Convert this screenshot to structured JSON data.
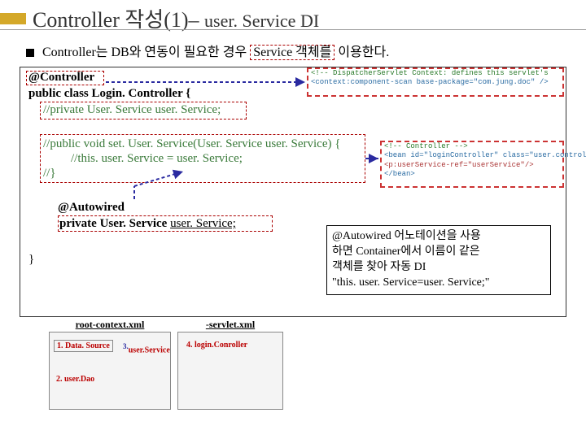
{
  "title_main": "Controller 작성(1)–",
  "title_sub": "user. Service  DI",
  "bullet": {
    "prefix": "Controller는  DB와 연동이 필요한 경우",
    "boxed": "Service 객체를",
    "suffix": "이용한다."
  },
  "code": {
    "l1": "@Controller",
    "l2": "public class Login. Controller {",
    "l3": "//private User. Service user. Service;",
    "l4": "//public void set. User. Service(User. Service user. Service) {",
    "l5": "//this. user. Service = user. Service;",
    "l6": "//}",
    "l7": "@Autowired",
    "l8": "private User. Service  user. Service;",
    "l9": "}"
  },
  "snippet1": {
    "a": "<!-- DispatcherServlet Context: defines this servlet's",
    "b": "<context:component-scan base-package=\"com.jung.doc\" />"
  },
  "snippet2": {
    "a": "<!-- Controller -->",
    "b": "<bean id=\"loginController\" class=\"user.controller.LoginController\">",
    "c": "  <p:userService-ref=\"userService\"/>",
    "d": "</bean>"
  },
  "note": {
    "l1": "@Autowired 어노테이션을 사용",
    "l2": "하면  Container에서 이름이 같은",
    "l3": "객체를 찾아 자동 DI",
    "l4": "\"this. user. Service=user. Service;\""
  },
  "containers": {
    "left_label": "root-context.xml",
    "right_label": "-servlet.xml",
    "item1": "1. Data. Source",
    "item2": "2. user.Dao",
    "item3_sup": "3.",
    "item3": "user.Service",
    "item4": "4. login.Conroller"
  }
}
